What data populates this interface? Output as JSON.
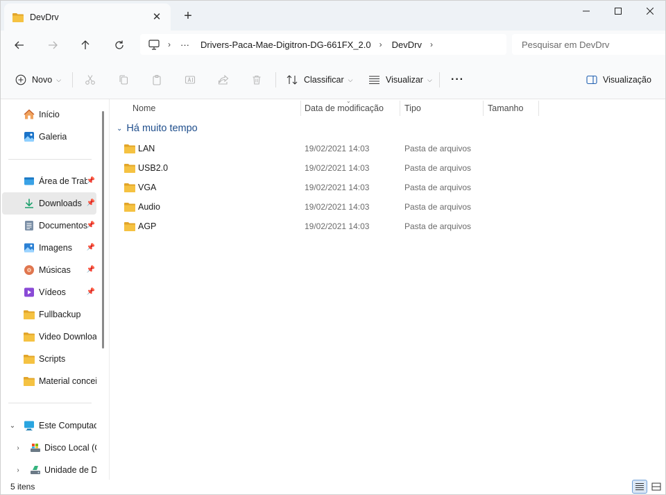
{
  "window": {
    "tab_title": "DevDrv",
    "tab_close": "✕",
    "new_tab": "+"
  },
  "address": {
    "ellipsis": "···",
    "segments": [
      "Drivers-Paca-Mae-Digitron-DG-661FX_2.0",
      "DevDrv"
    ]
  },
  "search": {
    "placeholder": "Pesquisar em DevDrv"
  },
  "toolbar": {
    "new_label": "Novo",
    "sort_label": "Classificar",
    "view_label": "Visualizar",
    "more_label": "···",
    "preview_label": "Visualização"
  },
  "sidebar": {
    "quick": [
      {
        "label": "Início",
        "icon": "home-icon"
      },
      {
        "label": "Galeria",
        "icon": "gallery-icon"
      }
    ],
    "pinned": [
      {
        "label": "Área de Trabalho",
        "icon": "desktop-icon",
        "pinned": true
      },
      {
        "label": "Downloads",
        "icon": "download-icon",
        "pinned": true,
        "selected": true
      },
      {
        "label": "Documentos",
        "icon": "documents-icon",
        "pinned": true
      },
      {
        "label": "Imagens",
        "icon": "pictures-icon",
        "pinned": true
      },
      {
        "label": "Músicas",
        "icon": "music-icon",
        "pinned": true
      },
      {
        "label": "Vídeos",
        "icon": "videos-icon",
        "pinned": true
      },
      {
        "label": "Fullbackup",
        "icon": "folder-icon"
      },
      {
        "label": "Video Downloader",
        "icon": "folder-icon"
      },
      {
        "label": "Scripts",
        "icon": "folder-icon"
      },
      {
        "label": "Material conceitual",
        "icon": "folder-icon"
      }
    ],
    "computer": {
      "label": "Este Computador",
      "children": [
        "Disco Local (C:)",
        "Unidade de DVD"
      ]
    }
  },
  "columns": {
    "name": "Nome",
    "date": "Data de modificação",
    "type": "Tipo",
    "size": "Tamanho"
  },
  "group": {
    "label": "Há muito tempo"
  },
  "files": [
    {
      "name": "LAN",
      "date": "19/02/2021 14:03",
      "type": "Pasta de arquivos"
    },
    {
      "name": "USB2.0",
      "date": "19/02/2021 14:03",
      "type": "Pasta de arquivos"
    },
    {
      "name": "VGA",
      "date": "19/02/2021 14:03",
      "type": "Pasta de arquivos"
    },
    {
      "name": "Audio",
      "date": "19/02/2021 14:03",
      "type": "Pasta de arquivos"
    },
    {
      "name": "AGP",
      "date": "19/02/2021 14:03",
      "type": "Pasta de arquivos"
    }
  ],
  "status": {
    "count": "5 itens"
  },
  "colors": {
    "folder": "#f5c242",
    "folder_dark": "#e2a52a",
    "accent": "#0067c0",
    "group_text": "#1f4e8c"
  }
}
